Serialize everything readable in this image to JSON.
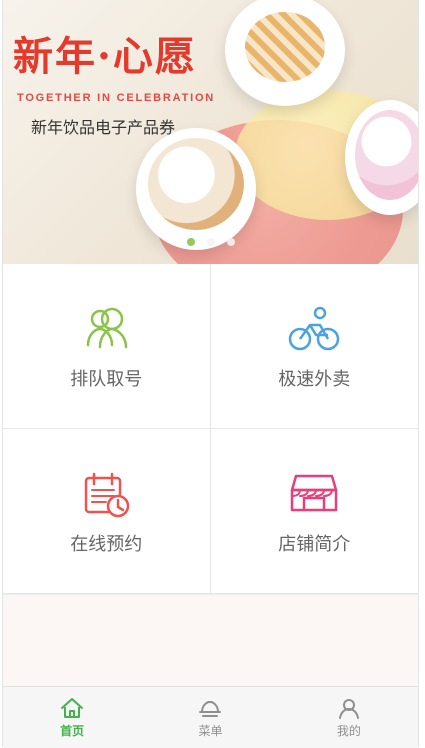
{
  "banner": {
    "title": "新年·心愿",
    "subtitle": "TOGETHER IN CELEBRATION",
    "description": "新年饮品电子产品券",
    "dots": [
      {
        "active": true
      },
      {
        "active": false
      },
      {
        "active": false
      }
    ]
  },
  "grid": {
    "items": [
      {
        "label": "排队取号",
        "icon": "people-icon",
        "color": "#8bc34a"
      },
      {
        "label": "极速外卖",
        "icon": "bicycle-icon",
        "color": "#4aa3df"
      },
      {
        "label": "在线预约",
        "icon": "calendar-clock-icon",
        "color": "#ef5350"
      },
      {
        "label": "店铺简介",
        "icon": "store-icon",
        "color": "#e83f7a"
      }
    ]
  },
  "tabbar": {
    "items": [
      {
        "label": "首页",
        "icon": "home-icon",
        "active": true,
        "color": "#43b24a"
      },
      {
        "label": "菜单",
        "icon": "cloche-icon",
        "active": false,
        "color": "#8f8f8f"
      },
      {
        "label": "我的",
        "icon": "user-icon",
        "active": false,
        "color": "#8f8f8f"
      }
    ]
  }
}
